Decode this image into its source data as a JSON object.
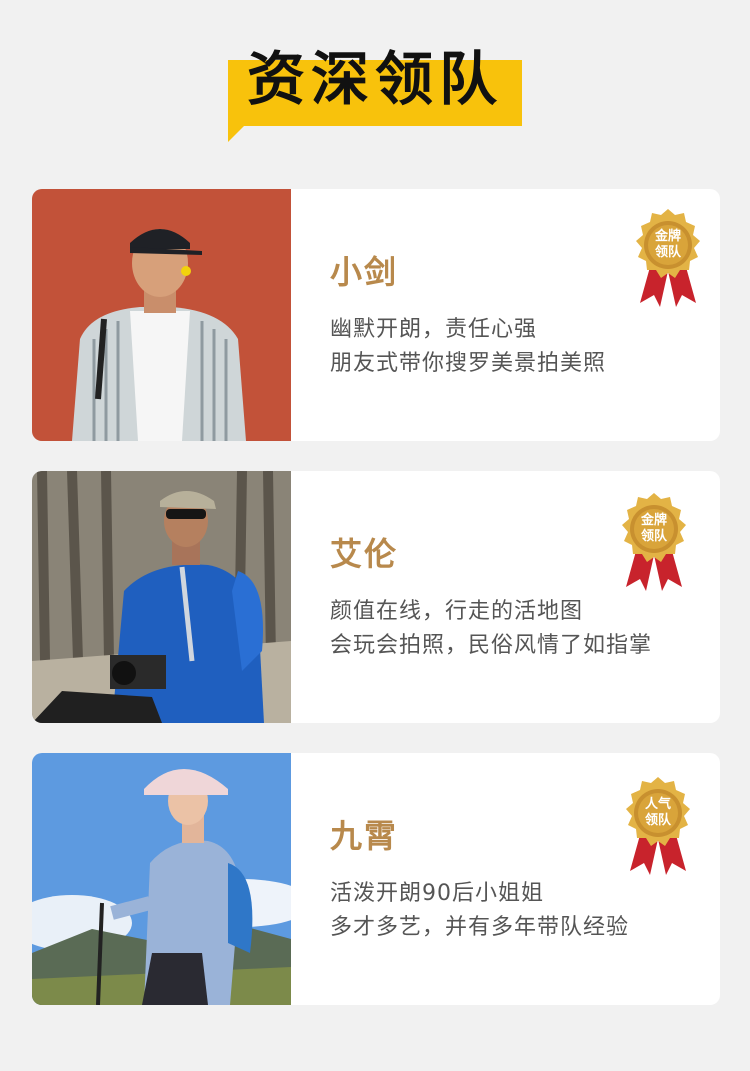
{
  "page": {
    "title": "资深领队"
  },
  "leaders": [
    {
      "name": "小剑",
      "badge_line1": "金牌",
      "badge_line2": "领队",
      "desc_line1": "幽默开朗，责任心强",
      "desc_line2": "朋友式带你搜罗美景拍美照"
    },
    {
      "name": "艾伦",
      "badge_line1": "金牌",
      "badge_line2": "领队",
      "desc_line1": "颜值在线，行走的活地图",
      "desc_line2": "会玩会拍照，民俗风情了如指掌"
    },
    {
      "name": "九霄",
      "badge_line1": "人气",
      "badge_line2": "领队",
      "desc_line1": "活泼开朗90后小姐姐",
      "desc_line2": "多才多艺，并有多年带队经验"
    }
  ],
  "colors": {
    "banner": "#f8c20c",
    "name": "#b8894c",
    "background": "#f1f1f1",
    "badge_gold": "#d9a43a",
    "badge_ribbon": "#c8232c"
  }
}
